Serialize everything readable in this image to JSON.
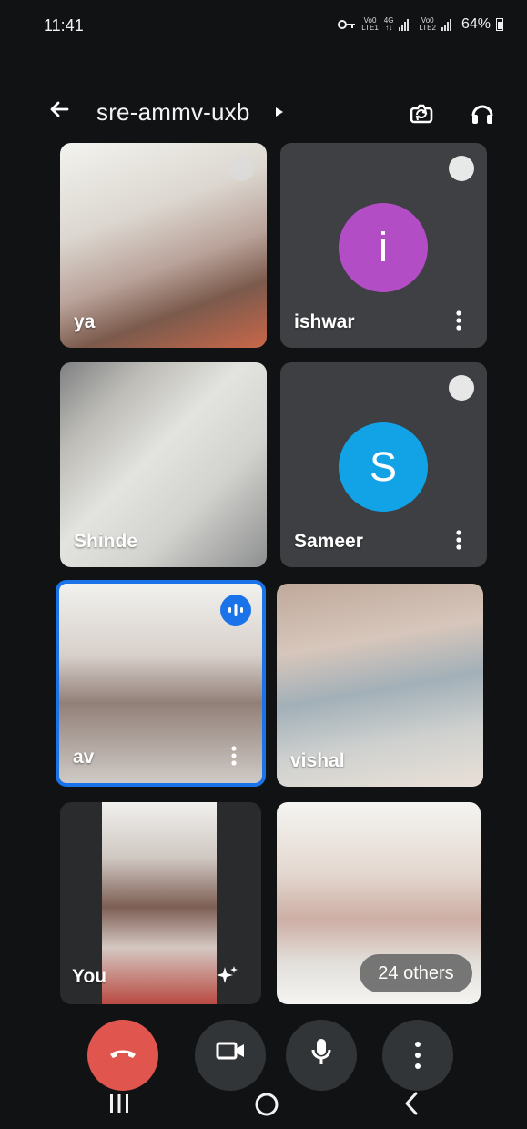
{
  "status": {
    "time": "11:41",
    "battery": "64%",
    "volte1": "Vo0",
    "lte1": "LTE1",
    "network4g": "4G",
    "volte2": "Vo0",
    "lte2": "LTE2"
  },
  "header": {
    "meeting_code": "sre-ammv-uxb"
  },
  "participants": [
    {
      "name": "ya",
      "type": "video"
    },
    {
      "name": "ishwar",
      "type": "avatar",
      "avatar_letter": "i",
      "avatar_color": "#B34DC6"
    },
    {
      "name": "Shinde",
      "type": "video"
    },
    {
      "name": "Sameer",
      "type": "avatar",
      "avatar_letter": "S",
      "avatar_color": "#12A3E6"
    },
    {
      "name": "av",
      "type": "video",
      "speaking": true
    },
    {
      "name": "vishal",
      "type": "video"
    },
    {
      "name": "You",
      "type": "self"
    },
    {
      "name": "",
      "type": "video",
      "others_label": "24 others"
    }
  ],
  "colors": {
    "end_call": "#E0564F",
    "control_bg": "#323538",
    "highlight": "#1A73E8"
  }
}
